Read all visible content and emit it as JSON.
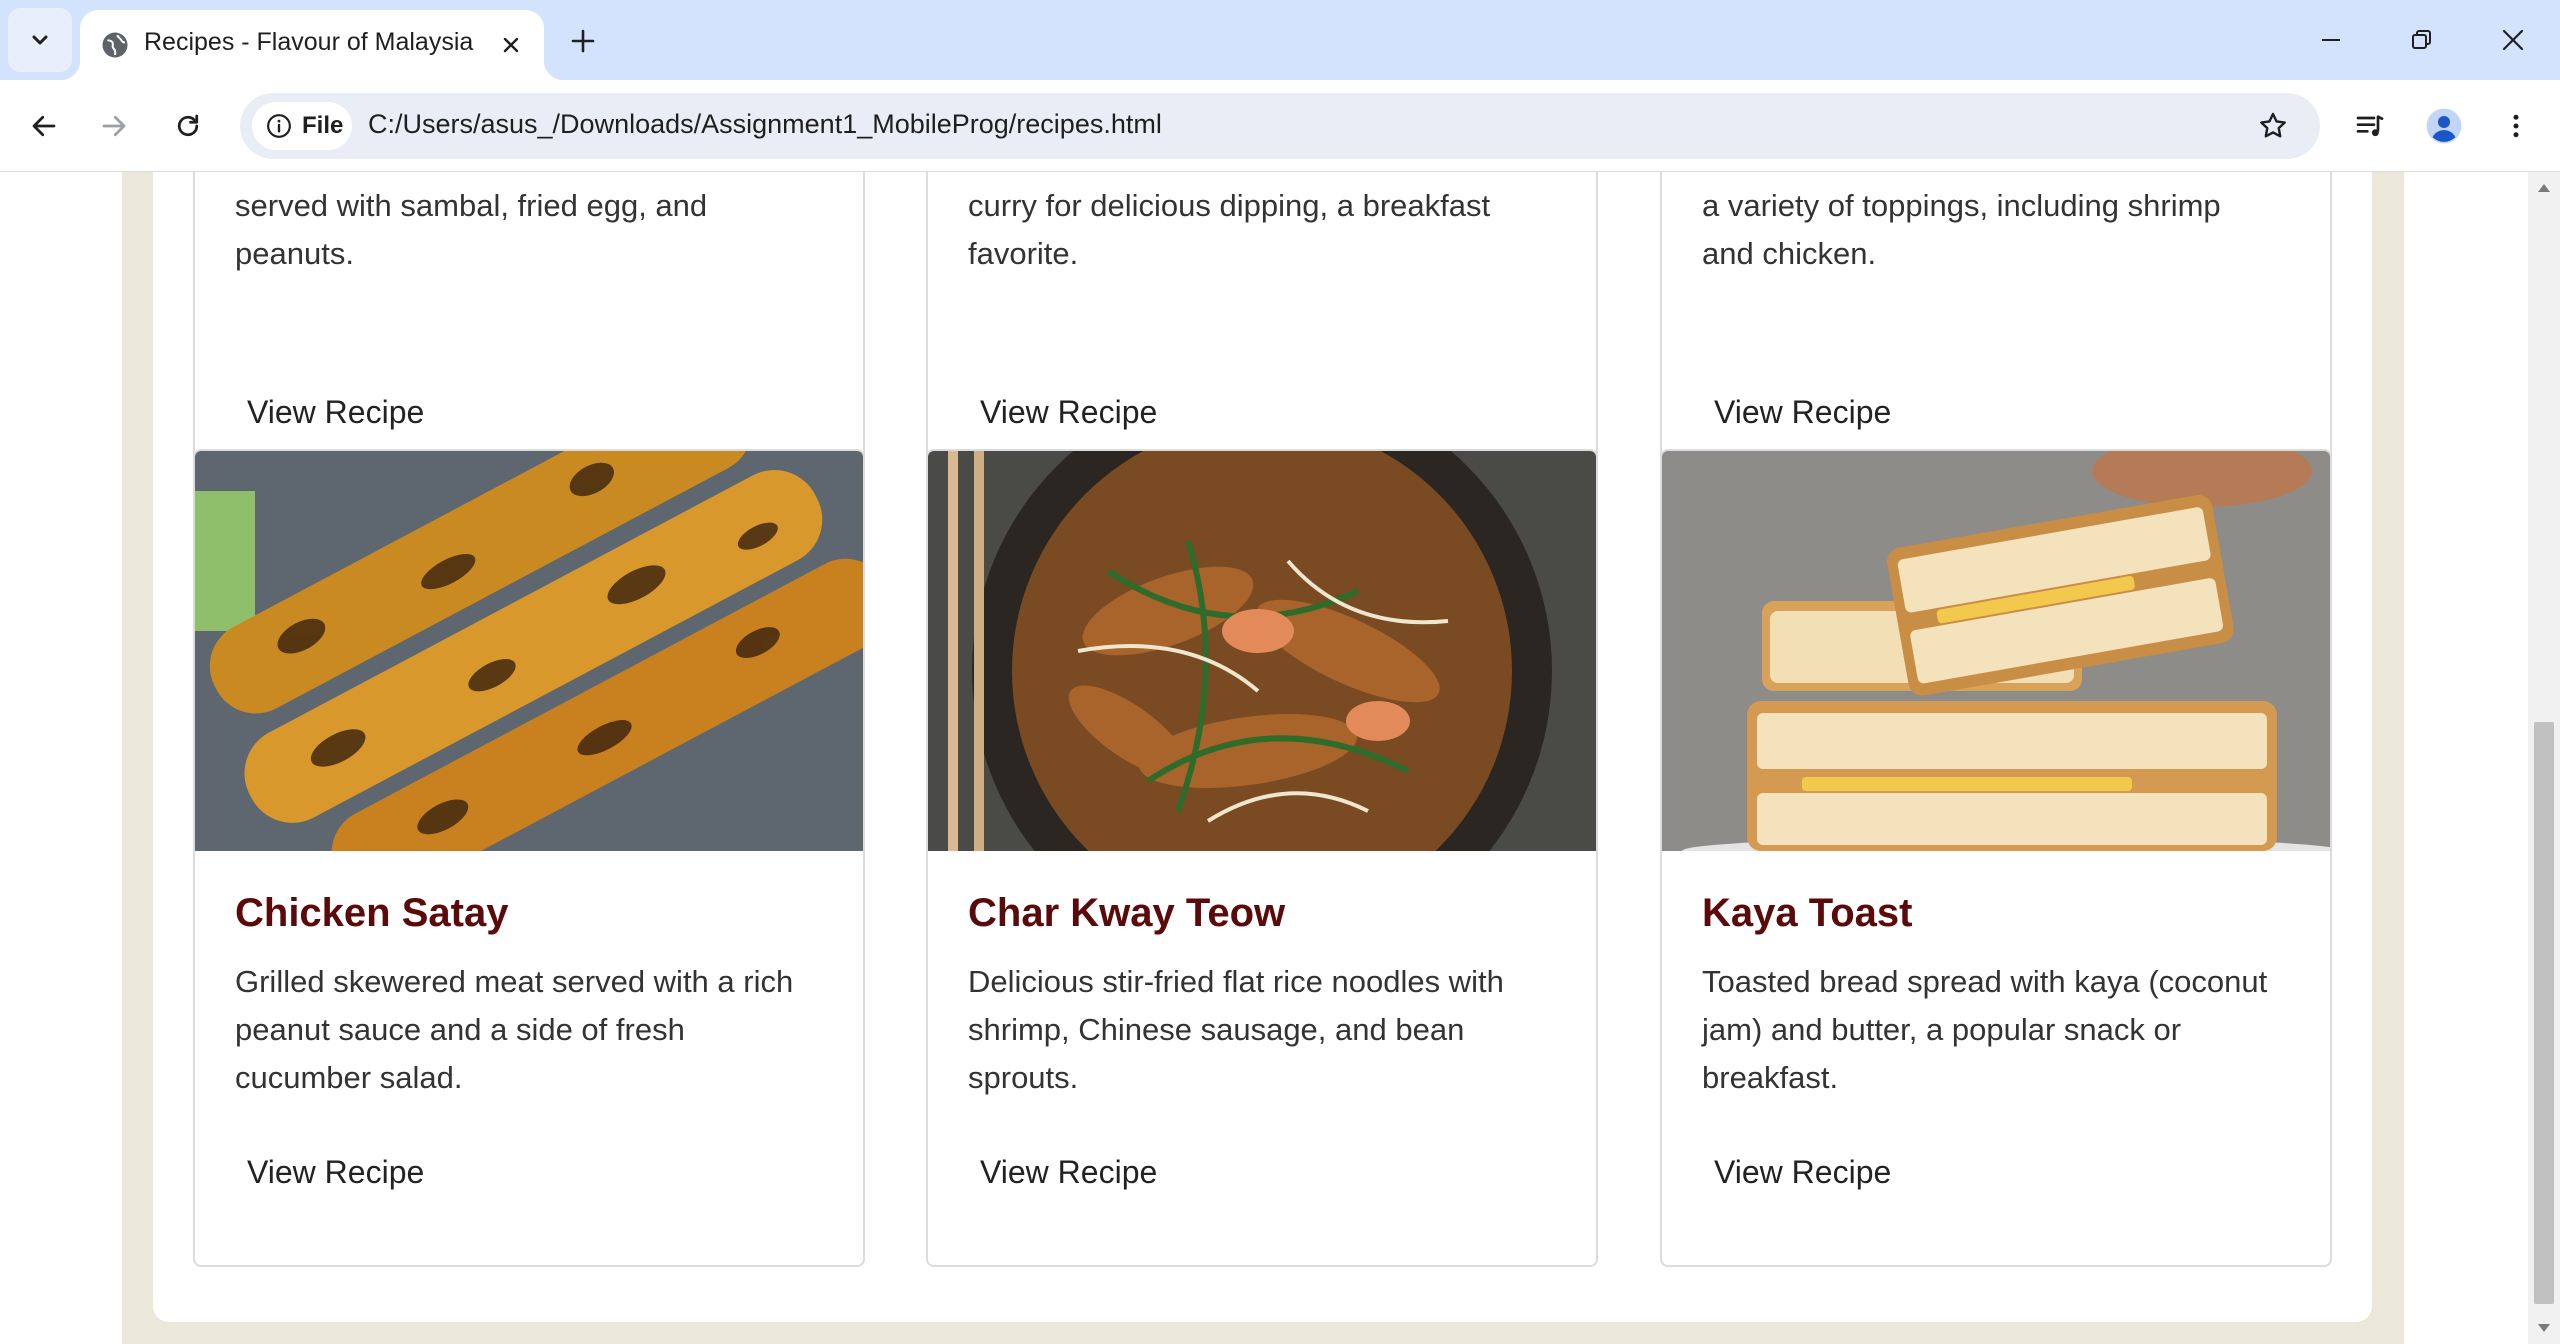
{
  "browser": {
    "tab_title": "Recipes - Flavour of Malaysia",
    "site_chip_label": "File",
    "url": "C:/Users/asus_/Downloads/Assignment1_MobileProg/recipes.html"
  },
  "recipes": {
    "top_row": [
      {
        "desc_lines": [
          "served with sambal, fried egg, and",
          "peanuts."
        ],
        "button": "View Recipe"
      },
      {
        "desc_lines": [
          "curry for delicious dipping, a breakfast",
          "favorite."
        ],
        "button": "View Recipe"
      },
      {
        "desc_lines": [
          "a variety of toppings, including shrimp",
          "and chicken."
        ],
        "button": "View Recipe"
      }
    ],
    "bottom_row": [
      {
        "title": "Chicken Satay",
        "description": "Grilled skewered meat served with a rich peanut sauce and a side of fresh cucumber salad.",
        "button": "View Recipe",
        "image": "chicken-satay-photo"
      },
      {
        "title": "Char Kway Teow",
        "description": "Delicious stir-fried flat rice noodles with shrimp, Chinese sausage, and bean sprouts.",
        "button": "View Recipe",
        "image": "char-kway-teow-photo"
      },
      {
        "title": "Kaya Toast",
        "description": "Toasted bread spread with kaya (coconut jam) and butter, a popular snack or breakfast.",
        "button": "View Recipe",
        "image": "kaya-toast-photo"
      }
    ]
  },
  "colors": {
    "accent_title": "#5a0a0a",
    "page_background": "#ece8d9",
    "tabstrip": "#d3e3fd"
  }
}
